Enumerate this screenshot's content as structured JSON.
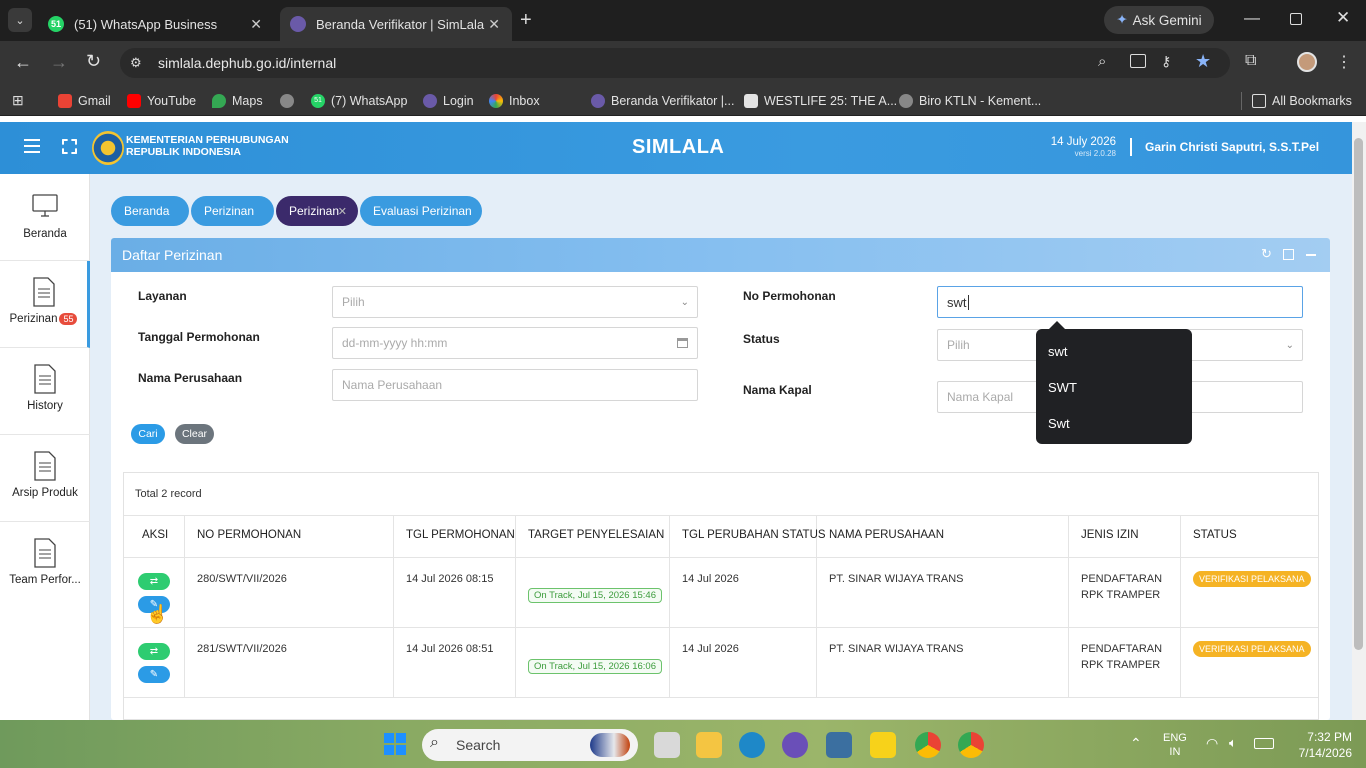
{
  "browser": {
    "tabs": [
      {
        "label": "(51) WhatsApp Business",
        "badge": "51"
      },
      {
        "label": "Beranda Verifikator | SimLala"
      }
    ],
    "ask_gemini": "Ask Gemini",
    "url": "simlala.dephub.go.id/internal",
    "bookmarks": [
      "Gmail",
      "YouTube",
      "Maps",
      "(7) WhatsApp",
      "Login",
      "Inbox",
      "Beranda Verifikator |...",
      "WESTLIFE 25: THE A...",
      "Biro KTLN - Kement..."
    ],
    "bookmark_badge": "51",
    "all_bookmarks": "All Bookmarks"
  },
  "app": {
    "ministry_line1": "KEMENTERIAN PERHUBUNGAN",
    "ministry_line2": "REPUBLIK INDONESIA",
    "title": "SIMLALA",
    "date": "14 July 2026",
    "version": "versi 2.0.28",
    "user": "Garin Christi Saputri, S.S.T.Pel"
  },
  "sidebar": {
    "items": [
      {
        "label": "Beranda",
        "icon": "monitor-icon"
      },
      {
        "label": "Perizinan",
        "badge": "55",
        "icon": "document-icon"
      },
      {
        "label": "History",
        "icon": "document-icon"
      },
      {
        "label": "Arsip Produk",
        "icon": "document-icon"
      },
      {
        "label": "Team Perfor...",
        "icon": "document-icon"
      }
    ]
  },
  "breadcrumbs": [
    "Beranda",
    "Perizinan",
    "Perizinan",
    "Evaluasi Perizinan"
  ],
  "panel": {
    "title": "Daftar Perizinan",
    "form": {
      "layanan_label": "Layanan",
      "layanan_placeholder": "Pilih",
      "tanggal_label": "Tanggal Permohonan",
      "tanggal_placeholder": "dd-mm-yyyy hh:mm",
      "nama_perusahaan_label": "Nama Perusahaan",
      "nama_perusahaan_placeholder": "Nama Perusahaan",
      "no_permohonan_label": "No Permohonan",
      "no_permohonan_value": "swt",
      "status_label": "Status",
      "status_placeholder": "Pilih",
      "nama_kapal_label": "Nama Kapal",
      "nama_kapal_placeholder": "Nama Kapal",
      "cari": "Cari",
      "clear": "Clear"
    },
    "autocomplete": [
      "swt",
      "SWT",
      "Swt"
    ],
    "total": "Total 2 record",
    "columns": [
      "AKSI",
      "NO PERMOHONAN",
      "TGL PERMOHONAN",
      "TARGET PENYELESAIAN",
      "TGL PERUBAHAN STATUS",
      "NAMA PERUSAHAAN",
      "JENIS IZIN",
      "STATUS"
    ],
    "rows": [
      {
        "no": "280/SWT/VII/2026",
        "tgl": "14 Jul 2026 08:15",
        "target": "On Track, Jul 15, 2026 15:46",
        "tgl_status": "14 Jul 2026",
        "perusahaan": "PT. SINAR WIJAYA TRANS",
        "jenis1": "PENDAFTARAN",
        "jenis2": "RPK TRAMPER",
        "status": "VERIFIKASI PELAKSANA"
      },
      {
        "no": "281/SWT/VII/2026",
        "tgl": "14 Jul 2026 08:51",
        "target": "On Track, Jul 15, 2026 16:06",
        "tgl_status": "14 Jul 2026",
        "perusahaan": "PT. SINAR WIJAYA TRANS",
        "jenis1": "PENDAFTARAN",
        "jenis2": "RPK TRAMPER",
        "status": "VERIFIKASI PELAKSANA"
      }
    ]
  },
  "taskbar": {
    "search": "Search",
    "lang1": "ENG",
    "lang2": "IN",
    "time": "7:32 PM",
    "date": "7/14/2026"
  },
  "colors": {
    "header_blue": "#3a9be0",
    "active_crumb": "#3b2a6b",
    "status_orange": "#f5b324",
    "action_green": "#2ecc71",
    "action_blue": "#2b9be6"
  }
}
